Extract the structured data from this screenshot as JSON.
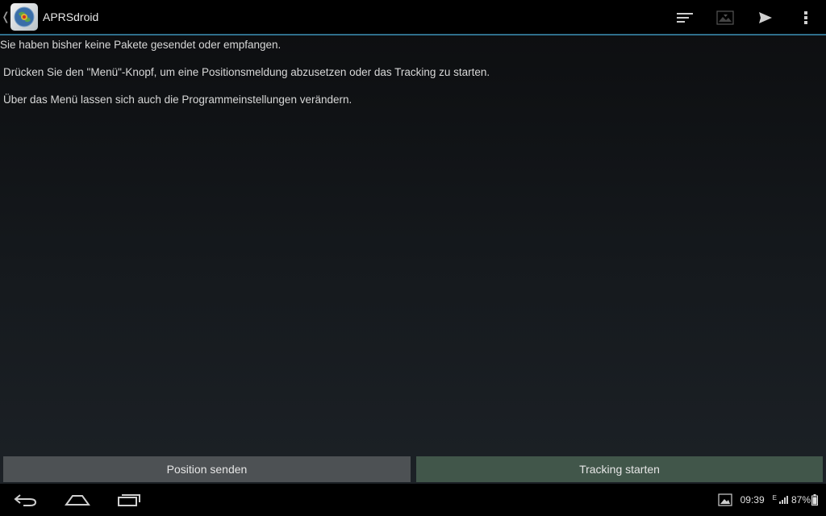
{
  "actionbar": {
    "title": "APRSdroid",
    "up_glyph": "❬",
    "icons": [
      "app-icon",
      "filter-icon",
      "map-icon",
      "send-icon",
      "overflow-menu-icon"
    ]
  },
  "content": {
    "line1": "Sie haben bisher keine Pakete gesendet oder empfangen.",
    "line2": "Drücken Sie den \"Menü\"-Knopf, um eine Positionsmeldung abzusetzen oder das Tracking zu starten.",
    "line3": "Über das Menü lassen sich auch die Programmeinstellungen verändern."
  },
  "buttons": {
    "position": "Position senden",
    "tracking": "Tracking starten"
  },
  "system_bar": {
    "time": "09:39",
    "network_letter": "E",
    "battery": "87%",
    "icons": [
      "back-icon",
      "home-icon",
      "recent-apps-icon",
      "gallery-notification-icon",
      "signal-icon",
      "battery-icon"
    ]
  },
  "colors": {
    "accent_line": "#2f6f8c",
    "button_position": "#4d5154",
    "button_tracking": "#41564a"
  }
}
